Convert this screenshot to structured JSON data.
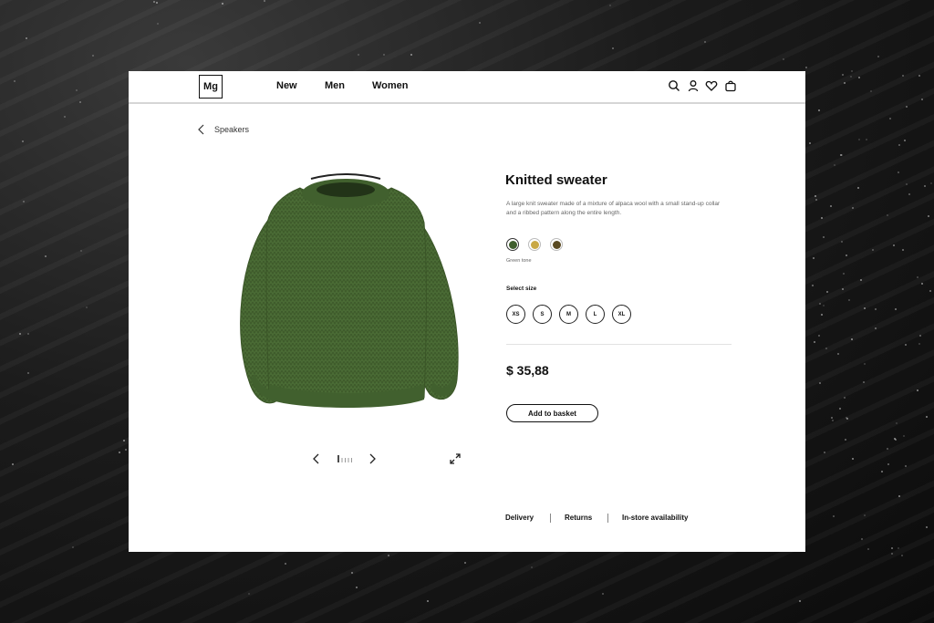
{
  "header": {
    "logo": "Mg",
    "nav": [
      "New",
      "Men",
      "Women"
    ],
    "icons": [
      "search-icon",
      "user-icon",
      "heart-icon",
      "basket-icon"
    ]
  },
  "breadcrumb": {
    "label": "Speakers"
  },
  "product": {
    "title": "Knitted sweater",
    "description": "A large knit sweater made of a mixture of alpaca wool with a small stand-up collar and a ribbed pattern along the entire length.",
    "colors": [
      {
        "hex": "#3f5e2d"
      },
      {
        "hex": "#c9a845"
      },
      {
        "hex": "#5a4a22"
      }
    ],
    "selected_color_label": "Green tone",
    "size_heading": "Select size",
    "sizes": [
      "XS",
      "S",
      "M",
      "L",
      "XL"
    ],
    "price": "$ 35,88",
    "add_button": "Add to basket"
  },
  "footer": {
    "links": [
      "Delivery",
      "Returns",
      "In-store availability"
    ]
  }
}
